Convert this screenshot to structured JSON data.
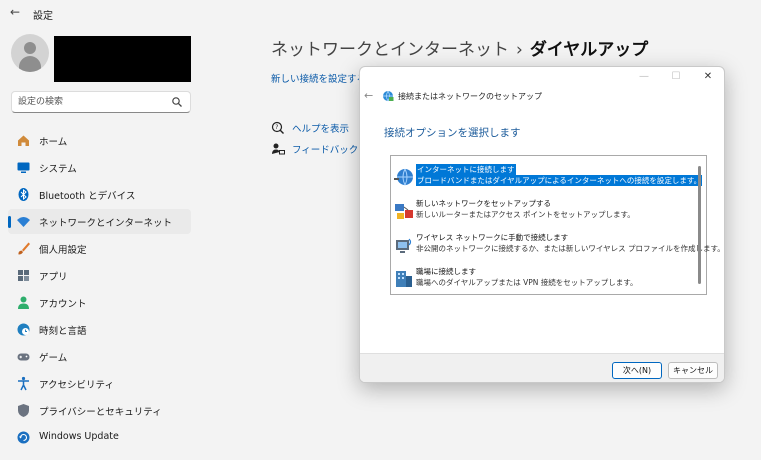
{
  "window": {
    "back_glyph": "←",
    "title": "設定"
  },
  "account": {
    "avatar": "person-avatar",
    "name_redacted": true
  },
  "search": {
    "placeholder": "設定の検索",
    "icon": "search-icon"
  },
  "nav": {
    "items": [
      {
        "label": "ホーム",
        "icon": "home-icon",
        "color": "#d08a3a",
        "selected": false
      },
      {
        "label": "システム",
        "icon": "system-display-icon",
        "color": "#0067c0",
        "selected": false
      },
      {
        "label": "Bluetooth とデバイス",
        "icon": "bluetooth-icon",
        "color": "#0067c0",
        "selected": false
      },
      {
        "label": "ネットワークとインターネット",
        "icon": "wifi-icon",
        "color": "#2a7fd4",
        "selected": true
      },
      {
        "label": "個人用設定",
        "icon": "brush-icon",
        "color": "#e07a2c",
        "selected": false
      },
      {
        "label": "アプリ",
        "icon": "apps-icon",
        "color": "#5a6a7a",
        "selected": false
      },
      {
        "label": "アカウント",
        "icon": "account-icon",
        "color": "#2eae6c",
        "selected": false
      },
      {
        "label": "時刻と言語",
        "icon": "globe-clock-icon",
        "color": "#1f7fc0",
        "selected": false
      },
      {
        "label": "ゲーム",
        "icon": "gamepad-icon",
        "color": "#6b7380",
        "selected": false
      },
      {
        "label": "アクセシビリティ",
        "icon": "accessibility-icon",
        "color": "#1a6fc0",
        "selected": false
      },
      {
        "label": "プライバシーとセキュリティ",
        "icon": "shield-icon",
        "color": "#6b7380",
        "selected": false
      },
      {
        "label": "Windows Update",
        "icon": "windows-update-icon",
        "color": "#1a6fc0",
        "selected": false
      }
    ]
  },
  "main": {
    "breadcrumb_parent": "ネットワークとインターネット",
    "breadcrumb_sep": "›",
    "breadcrumb_current": "ダイヤルアップ",
    "new_connection_link": "新しい接続を設定する",
    "help_link": "ヘルプを表示",
    "feedback_link": "フィードバックの送信"
  },
  "dialog": {
    "minimize_glyph": "—",
    "maximize_glyph": "☐",
    "close_glyph": "✕",
    "back_glyph": "←",
    "title": "接続またはネットワークのセットアップ",
    "heading": "接続オプションを選択します",
    "options": [
      {
        "title": "インターネットに接続します",
        "desc": "ブロードバンドまたはダイヤルアップによるインターネットへの接続を設定します。",
        "icon": "internet-globe-icon",
        "selected": true
      },
      {
        "title": "新しいネットワークをセットアップする",
        "desc": "新しいルーターまたはアクセス ポイントをセットアップします。",
        "icon": "network-router-icon",
        "selected": false
      },
      {
        "title": "ワイヤレス ネットワークに手動で接続します",
        "desc": "非公開のネットワークに接続するか、または新しいワイヤレス プロファイルを作成します。",
        "icon": "wireless-network-icon",
        "selected": false
      },
      {
        "title": "職場に接続します",
        "desc": "職場へのダイヤルアップまたは VPN 接続をセットアップします。",
        "icon": "workplace-vpn-icon",
        "selected": false
      }
    ],
    "next_button": "次へ(N)",
    "cancel_button": "キャンセル"
  }
}
